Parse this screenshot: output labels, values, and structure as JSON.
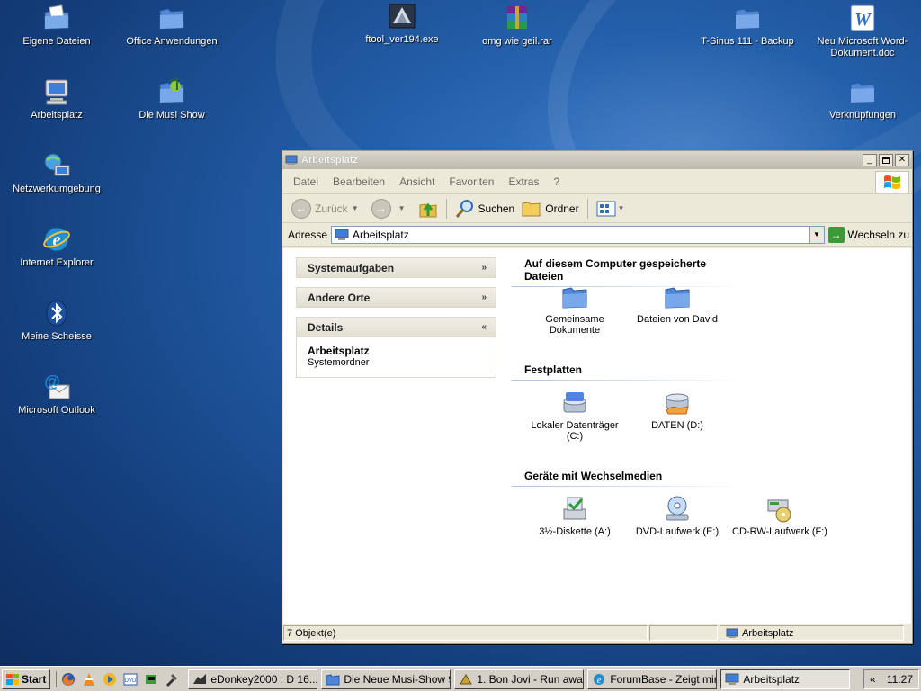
{
  "desktop": {
    "icons": [
      {
        "label": "Eigene Dateien",
        "icon": "my-documents-icon"
      },
      {
        "label": "Office Anwendungen",
        "icon": "folder-icon"
      },
      {
        "label": "ftool_ver194.exe",
        "icon": "exe-icon"
      },
      {
        "label": "omg wie geil.rar",
        "icon": "rar-archive-icon"
      },
      {
        "label": "T-Sinus 111 - Backup",
        "icon": "folder-icon"
      },
      {
        "label": "Neu Microsoft Word-Dokument.doc",
        "icon": "word-document-icon"
      },
      {
        "label": "Arbeitsplatz",
        "icon": "my-computer-icon"
      },
      {
        "label": "Die Musi Show",
        "icon": "music-folder-icon"
      },
      {
        "label": "Verknüpfungen",
        "icon": "folder-icon"
      },
      {
        "label": "Netzwerkumgebung",
        "icon": "network-places-icon"
      },
      {
        "label": "Internet Explorer",
        "icon": "internet-explorer-icon"
      },
      {
        "label": "Meine Scheisse",
        "icon": "bluetooth-icon"
      },
      {
        "label": "Microsoft Outlook",
        "icon": "outlook-icon"
      }
    ]
  },
  "window": {
    "title": "Arbeitsplatz",
    "menu": [
      "Datei",
      "Bearbeiten",
      "Ansicht",
      "Favoriten",
      "Extras",
      "?"
    ],
    "toolbar": {
      "back": "Zurück",
      "search": "Suchen",
      "folders": "Ordner"
    },
    "address": {
      "label": "Adresse",
      "value": "Arbeitsplatz",
      "go": "Wechseln zu"
    },
    "tasks": {
      "system": "Systemaufgaben",
      "other": "Andere Orte",
      "details": "Details",
      "details_name": "Arbeitsplatz",
      "details_type": "Systemordner"
    },
    "sections": {
      "files_title": "Auf diesem Computer gespeicherte Dateien",
      "files": [
        "Gemeinsame Dokumente",
        "Dateien von David"
      ],
      "drives_title": "Festplatten",
      "drives": [
        "Lokaler Datenträger (C:)",
        "DATEN (D:)"
      ],
      "removable_title": "Geräte mit Wechselmedien",
      "removable": [
        "3½-Diskette (A:)",
        "DVD-Laufwerk (E:)",
        "CD-RW-Laufwerk (F:)"
      ]
    },
    "status": {
      "count": "7 Objekt(e)",
      "location": "Arbeitsplatz"
    }
  },
  "taskbar": {
    "start": "Start",
    "tasks": [
      "eDonkey2000 : D 16....",
      "Die Neue Musi-Show 9...",
      "1. Bon Jovi - Run awa...",
      "ForumBase - Zeigt mir ...",
      "Arbeitsplatz"
    ],
    "tray_arrow": "«",
    "clock": "11:27"
  },
  "colors": {
    "desktop_blue": "#235ea8",
    "folder_blue": "#4f86d6",
    "window_face": "#ece9d8"
  }
}
